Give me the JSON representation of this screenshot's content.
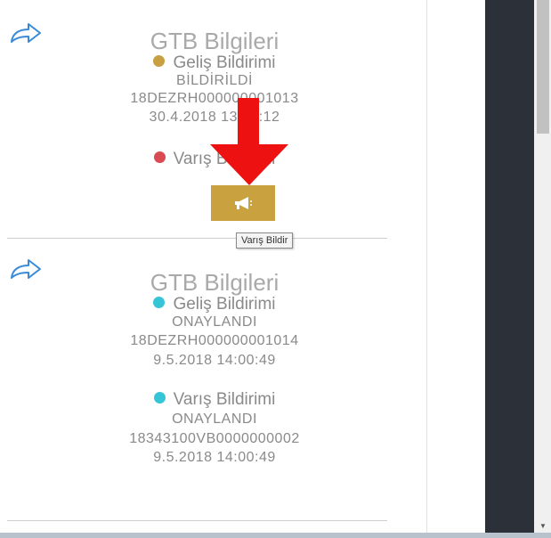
{
  "cards": [
    {
      "title": "GTB Bilgileri",
      "gelis": {
        "label": "Geliş Bildirimi",
        "status": "BİLDİRİLDİ",
        "ref": "18DEZRH000000001013",
        "datetime": "30.4.2018 13:03:12",
        "dot_color": "#c8a041"
      },
      "varis": {
        "label": "Varış Bildirimi",
        "dot_color": "#d94a52"
      }
    },
    {
      "title": "GTB Bilgileri",
      "gelis": {
        "label": "Geliş Bildirimi",
        "status": "ONAYLANDI",
        "ref": "18DEZRH000000001014",
        "datetime": "9.5.2018 14:00:49",
        "dot_color": "#36c5d6"
      },
      "varis": {
        "label": "Varış Bildirimi",
        "status": "ONAYLANDI",
        "ref": "18343100VB0000000002",
        "datetime": "9.5.2018 14:00:49",
        "dot_color": "#36c5d6"
      }
    }
  ],
  "action": {
    "icon": "bullhorn-icon",
    "tooltip": "Varış Bildir",
    "color": "#c9a23f"
  },
  "share_icon": "share-icon"
}
